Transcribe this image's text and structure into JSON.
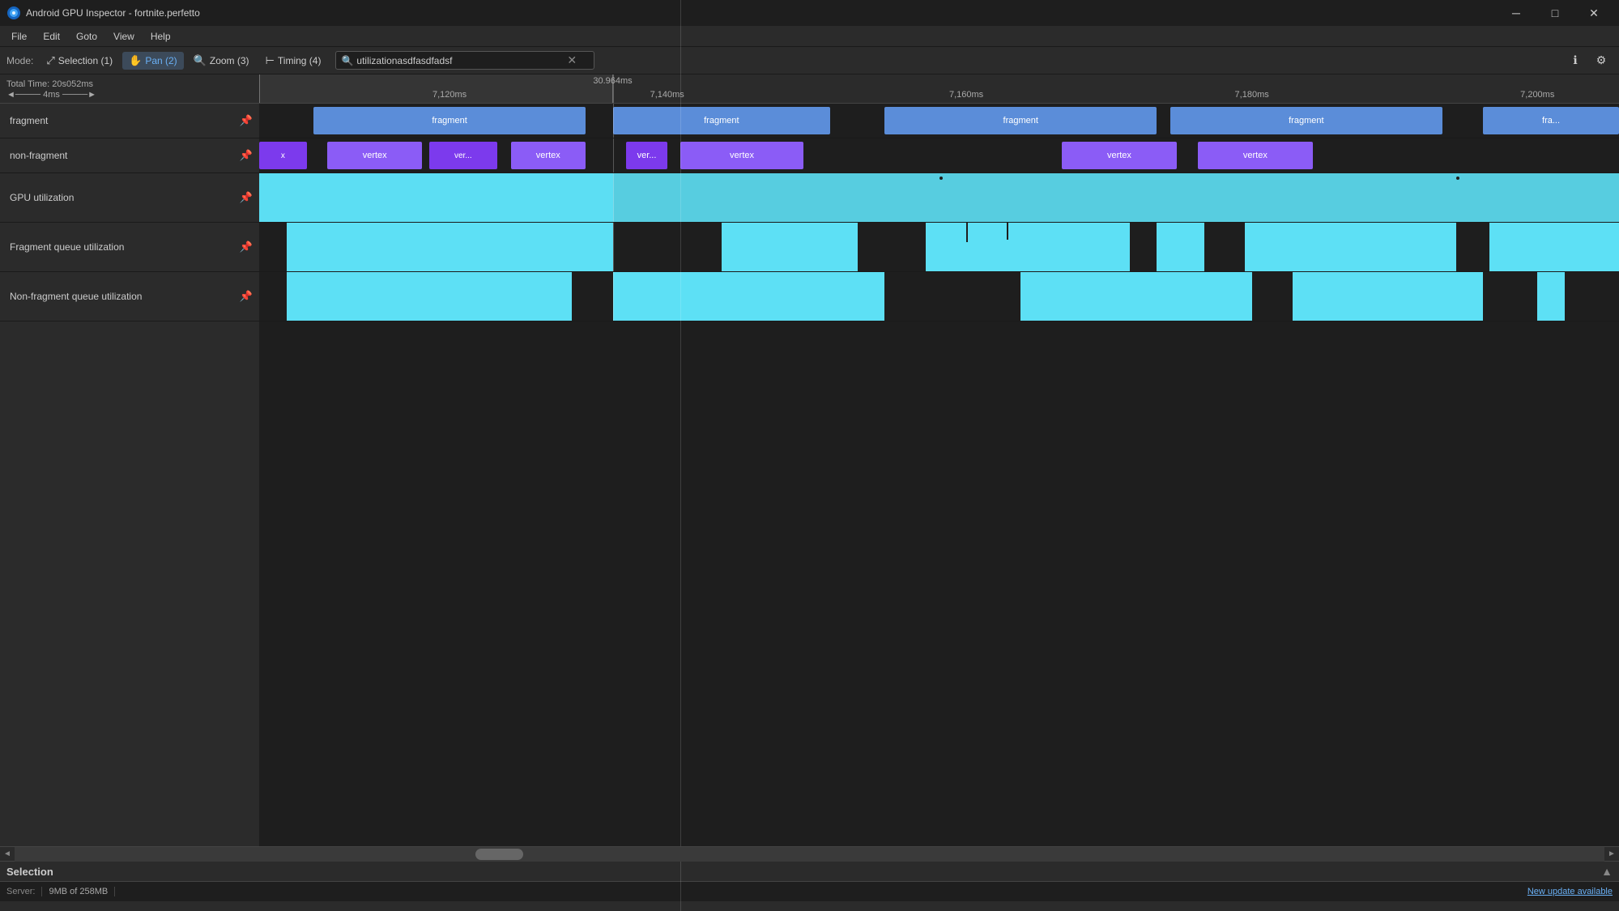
{
  "window": {
    "title": "Android GPU Inspector - fortnite.perfetto",
    "controls": {
      "minimize": "─",
      "maximize": "□",
      "close": "✕"
    }
  },
  "menu": {
    "items": [
      "File",
      "Edit",
      "Goto",
      "View",
      "Help"
    ]
  },
  "mode_bar": {
    "mode_label": "Mode:",
    "modes": [
      {
        "id": "selection",
        "label": "Selection (1)",
        "icon": "⤢",
        "active": false
      },
      {
        "id": "pan",
        "label": "Pan (2)",
        "icon": "✋",
        "active": true
      },
      {
        "id": "zoom",
        "label": "Zoom (3)",
        "icon": "🔍",
        "active": false
      },
      {
        "id": "timing",
        "label": "Timing (4)",
        "icon": "⊢",
        "active": false
      }
    ],
    "search_placeholder": "utilizationasdfasdfadsf",
    "search_value": "utilizationasdfasdfadsf"
  },
  "timeline": {
    "total_time": "Total Time: 20s052ms",
    "scale": "4ms",
    "selection_start": "30.964ms",
    "ticks": [
      {
        "label": "7,120ms",
        "pct": 14
      },
      {
        "label": "7,140ms",
        "pct": 30
      },
      {
        "label": "7,160ms",
        "pct": 52
      },
      {
        "label": "7,180ms",
        "pct": 73
      },
      {
        "label": "7,200ms",
        "pct": 94
      }
    ]
  },
  "tracks": [
    {
      "id": "fragment",
      "label": "fragment",
      "pin": true,
      "type": "fragment"
    },
    {
      "id": "non-fragment",
      "label": "non-fragment",
      "pin": true,
      "type": "non-fragment"
    },
    {
      "id": "gpu-util",
      "label": "GPU utilization",
      "pin": true,
      "type": "gpu-util"
    },
    {
      "id": "frag-queue",
      "label": "Fragment queue utilization",
      "pin": true,
      "type": "frag-queue"
    },
    {
      "id": "nonfrag-queue",
      "label": "Non-fragment queue utilization",
      "pin": true,
      "type": "nonfrag-queue"
    }
  ],
  "bottom": {
    "selection_title": "Selection",
    "server_label": "Server:",
    "server_value": "9MB of 258MB",
    "update_text": "New update available"
  }
}
